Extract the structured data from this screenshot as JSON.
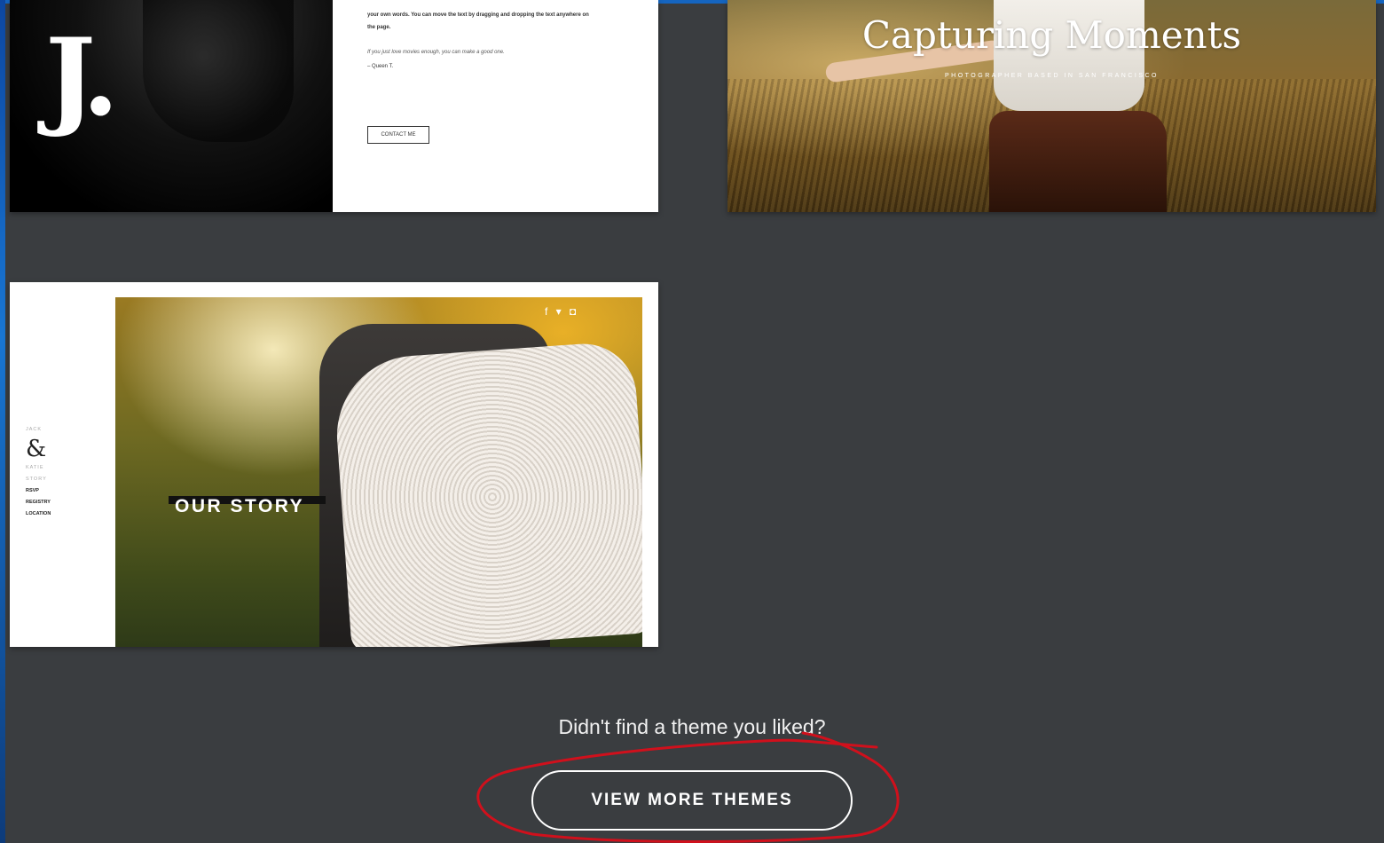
{
  "themes": [
    {
      "logo": "J.",
      "body_text": "your own words. You can move the text by dragging and dropping the text anywhere on",
      "body_text_2": "the page.",
      "quote": "If you just love movies enough, you can make a good one.",
      "author": "– Queen T.",
      "button": "CONTACT ME"
    },
    {
      "title": "Capturing Moments",
      "subtitle": "PHOTOGRAPHER BASED IN SAN FRANCISCO"
    },
    {
      "nav": {
        "name_top": "JACK",
        "amp": "&",
        "name_bottom": "KATIE",
        "items": [
          "STORY",
          "RSVP",
          "REGISTRY",
          "LOCATION"
        ]
      },
      "social": "f ▾ ◘",
      "headline": "OUR STORY"
    }
  ],
  "footer": {
    "prompt": "Didn't find a theme you liked?",
    "button": "VIEW MORE THEMES"
  },
  "colors": {
    "page_bg": "#3a3d40",
    "annotation": "#d0101c"
  }
}
